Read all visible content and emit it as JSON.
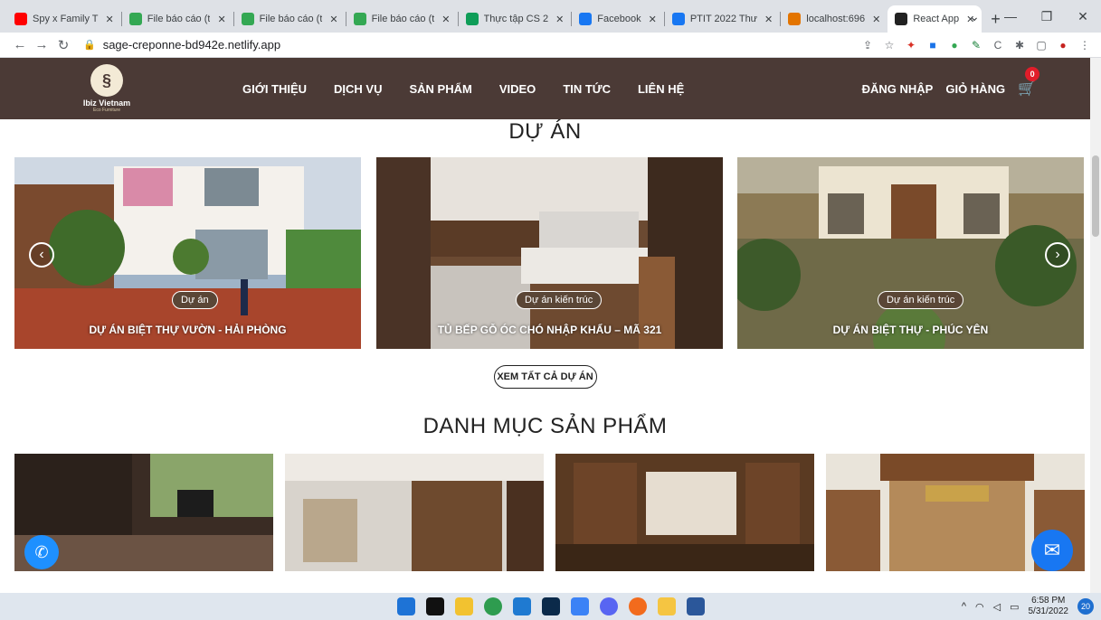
{
  "browser": {
    "tabs": [
      {
        "title": "Spy x Family T",
        "icon": "youtube-icon",
        "color": "#ff0000"
      },
      {
        "title": "File báo cáo (t",
        "icon": "drive-icon",
        "color": "#34a853"
      },
      {
        "title": "File báo cáo (t",
        "icon": "drive-icon",
        "color": "#34a853"
      },
      {
        "title": "File báo cáo (t",
        "icon": "drive-icon",
        "color": "#34a853"
      },
      {
        "title": "Thực tập CS 2",
        "icon": "sheets-icon",
        "color": "#0f9d58"
      },
      {
        "title": "Facebook",
        "icon": "facebook-icon",
        "color": "#1877f2"
      },
      {
        "title": "PTIT 2022 Thư",
        "icon": "facebook-icon",
        "color": "#1877f2"
      },
      {
        "title": "localhost:696",
        "icon": "localhost-icon",
        "color": "#e37400"
      },
      {
        "title": "React App",
        "icon": "react-icon",
        "color": "#222222"
      }
    ],
    "url": "sage-creponne-bd942e.netlify.app"
  },
  "site": {
    "logo": {
      "name": "Ibiz Vietnam",
      "tagline": "Eco Furniture"
    },
    "nav": [
      "GIỚI THIỆU",
      "DỊCH VỤ",
      "SẢN PHẨM",
      "VIDEO",
      "TIN TỨC",
      "LIÊN HỆ"
    ],
    "login": "ĐĂNG NHẬP",
    "cart_label": "GIỎ HÀNG",
    "cart_count": "0",
    "accent": "#4b3a36"
  },
  "projects": {
    "title": "DỰ ÁN",
    "items": [
      {
        "badge": "Dự án",
        "caption": "DỰ ÁN BIỆT THỰ VƯỜN - HẢI PHÒNG"
      },
      {
        "badge": "Dự án kiến trúc",
        "caption": "TỦ BẾP GỖ ÓC CHÓ NHẬP KHẨU – MÃ 321"
      },
      {
        "badge": "Dự án kiến trúc",
        "caption": "DỰ ÁN BIỆT THỰ - PHÚC YÊN"
      }
    ],
    "view_all": "XEM TẤT CẢ DỰ ÁN"
  },
  "categories": {
    "title": "DANH MỤC SẢN PHẨM"
  },
  "taskbar": {
    "time": "6:58 PM",
    "date": "5/31/2022",
    "notifications": "20"
  }
}
